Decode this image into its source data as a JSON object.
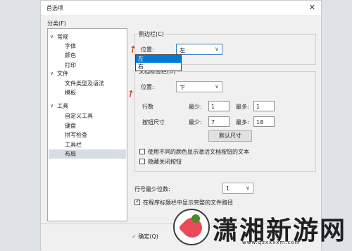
{
  "dialog": {
    "title": "首选项",
    "close_glyph": "✕"
  },
  "category": {
    "header": "分类(F)",
    "tree": [
      {
        "label": "常规",
        "expanded": true
      },
      {
        "label": "字体"
      },
      {
        "label": "颜色"
      },
      {
        "label": "打印"
      },
      {
        "label": "文件",
        "expanded": true
      },
      {
        "label": "文件类型及语法"
      },
      {
        "label": "模板"
      },
      {
        "label": "工具",
        "expanded": true
      },
      {
        "label": "自定义工具"
      },
      {
        "label": "键盘"
      },
      {
        "label": "拼写检查"
      },
      {
        "label": "工具栏"
      },
      {
        "label": "布局",
        "selected": true
      }
    ]
  },
  "sidebar_group": {
    "title": "侧边栏(C)",
    "position_label": "位置:",
    "position_value": "左",
    "position_options": [
      "左",
      "右"
    ],
    "highlighted_option": "左"
  },
  "doc_tab_group": {
    "title": "文档标签栏(D)",
    "position_label": "位置:",
    "position_value": "下",
    "rows_label": "行数",
    "min_label": "最少:",
    "max_label": "最多:",
    "rows_min": "1",
    "rows_max": "1",
    "button_size_label": "按钮尺寸",
    "size_min": "7",
    "size_max": "18",
    "default_size_button": "默认尺寸",
    "check_color": "使用不同的颜色显示激活文档按钮的文本",
    "check_hide_close": "隐藏关闭按钮"
  },
  "line_number": {
    "label": "行号最少位数:",
    "value": "1"
  },
  "show_path": {
    "label": "在程序标题栏中显示完整的文件路径",
    "checked": true
  },
  "ok_button": "确定(Q)",
  "watermark": {
    "text": "潇湘新游网",
    "url": "www.qzxxxxm.com"
  },
  "colors": {
    "accent": "#0078d7",
    "arrow": "#d9372c"
  }
}
